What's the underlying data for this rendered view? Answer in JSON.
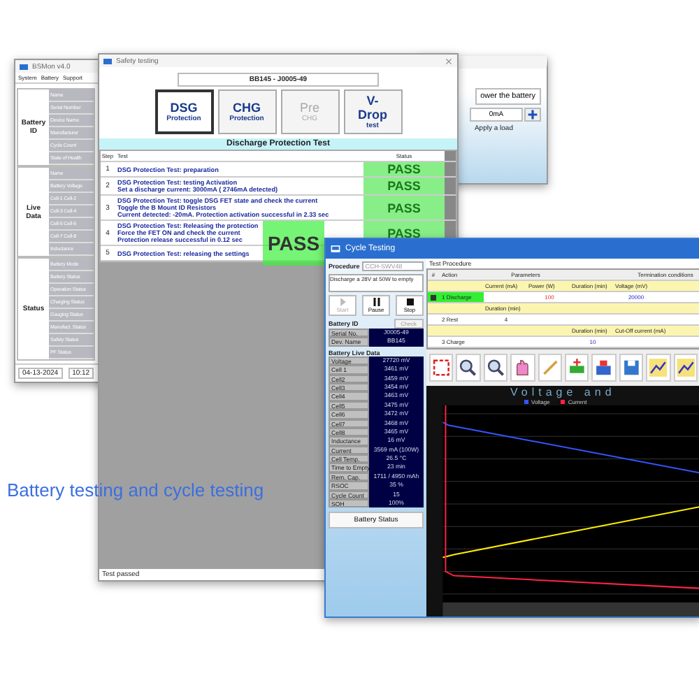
{
  "main_window": {
    "title": "BSMon v4.0",
    "menu": [
      "System",
      "Battery",
      "Support"
    ],
    "groups": [
      {
        "label": "Battery ID",
        "fields": [
          "Name",
          "Serial Number",
          "Device Name",
          "Manufacturer",
          "Cycle Count",
          "State of Health"
        ]
      },
      {
        "label": "Live Data",
        "fields": [
          "Name",
          "Battery Voltage",
          "Cell-1 Cell-2",
          "Cell-3 Cell-4",
          "Cell-5 Cell-6",
          "Cell-7 Cell-8",
          "Inductance"
        ]
      },
      {
        "label": "Status",
        "fields": [
          "Battery Mode",
          "Battery Status",
          "Operation Status",
          "Charging Status",
          "Gauging Status",
          "Manufact. Status",
          "Safety Status",
          "PF Status"
        ]
      }
    ],
    "status_bar": [
      "04-13-2024",
      "10:12"
    ]
  },
  "load_window": {
    "power_button": "ower the battery",
    "current_field": "0mA",
    "apply_label": "Apply a load"
  },
  "safety_window": {
    "title": "Safety testing",
    "battery": "BB145 - J0005-49",
    "tests": [
      {
        "label": "DSG",
        "sub": "Protection",
        "selected": true,
        "disabled": false
      },
      {
        "label": "CHG",
        "sub": "Protection",
        "selected": false,
        "disabled": false
      },
      {
        "label": "Pre",
        "sub": "CHG",
        "selected": false,
        "disabled": true
      },
      {
        "label": "V-Drop",
        "sub": "test",
        "selected": false,
        "disabled": false
      }
    ],
    "section_title": "Discharge Protection Test",
    "columns": [
      "Step",
      "Test",
      "Status"
    ],
    "steps": [
      {
        "step": "1",
        "lines": [
          "DSG Protection Test: preparation"
        ],
        "status": "PASS"
      },
      {
        "step": "2",
        "lines": [
          "DSG Protection Test: testing Activation",
          "Set a discharge current: 3000mA ( 2746mA detected)"
        ],
        "status": "PASS"
      },
      {
        "step": "3",
        "lines": [
          "DSG Protection Test: toggle DSG FET state and check the current",
          "Toggle the B Mount ID Resistors",
          "Current detected: -20mA. Protection activation successful in 2.33 sec"
        ],
        "status": "PASS"
      },
      {
        "step": "4",
        "lines": [
          "DSG Protection Test: Releasing the protection",
          "Force the FET ON and check the current",
          "Protection release successful in 0.12 sec"
        ],
        "status": "PASS"
      },
      {
        "step": "5",
        "lines": [
          "DSG Protection Test: releasing the settings"
        ]
      }
    ],
    "result": "PASS",
    "status_bar": "Test passed"
  },
  "cycle_window": {
    "title": "Cycle Testing",
    "procedure_label": "Procedure",
    "procedure": "CCH-SWV48",
    "description": "Discharge a 28V at 50W to empty",
    "controls": [
      {
        "label": "Start",
        "kind": "start",
        "disabled": true
      },
      {
        "label": "Pause",
        "kind": "pause",
        "disabled": false
      },
      {
        "label": "Stop",
        "kind": "stop",
        "disabled": false
      }
    ],
    "battery_id_label": "Battery ID",
    "check_button": "Check",
    "id_fields": [
      {
        "name": "Serial No.",
        "value": "J0005-49"
      },
      {
        "name": "Dev. Name",
        "value": "BB145"
      }
    ],
    "live_label": "Battery Live Data",
    "live_fields": [
      {
        "name": "Voltage",
        "value": "27720 mV"
      },
      {
        "name": "Cell 1",
        "value": "3461 mV"
      },
      {
        "name": "Cell2",
        "value": "3459 mV"
      },
      {
        "name": "Cell3",
        "value": "3454 mV"
      },
      {
        "name": "Cell4",
        "value": "3463 mV"
      },
      {
        "name": "Cell5",
        "value": "3475 mV"
      },
      {
        "name": "Cell6",
        "value": "3472 mV"
      },
      {
        "name": "Cell7",
        "value": "3468 mV"
      },
      {
        "name": "Cell8",
        "value": "3465 mV"
      },
      {
        "name": "Inductance",
        "value": "16 mV"
      },
      {
        "name": "Current",
        "value": "3569 mA (100W)"
      },
      {
        "name": "Cell Temp.",
        "value": "26.5 °C"
      },
      {
        "name": "Time to Empty",
        "value": "23 min"
      },
      {
        "name": "Rem. Cap.",
        "value": "1711 / 4950 mAh"
      },
      {
        "name": "RSOC",
        "value": "35 %"
      },
      {
        "name": "Cycle Count",
        "value": "15"
      },
      {
        "name": "SOH",
        "value": "100%"
      }
    ],
    "status_button": "Battery Status",
    "procedure_title": "Test Procedure",
    "proc_columns": [
      "#",
      "Action",
      "Parameters",
      "Termination conditions"
    ],
    "proc_rows": [
      {
        "action": "1 Discharge",
        "selected": true,
        "cells": [
          {
            "label": "Current (mA)"
          },
          {
            "label": "Power (W)",
            "value": "100"
          },
          {
            "label": "Duration (min)"
          },
          {
            "label": "Voltage (mV)",
            "value": "20000"
          }
        ]
      },
      {
        "action": "2 Rest",
        "selected": false,
        "cells": [
          {
            "label": "Duration (min)",
            "value": "4"
          },
          null,
          null,
          null
        ]
      },
      {
        "action": "3 Charge",
        "selected": false,
        "cells": [
          null,
          null,
          {
            "label": "Duration (min)",
            "value": "10"
          },
          {
            "label": "Cut-Off current (mA)"
          }
        ]
      }
    ],
    "chart_title": "Voltage and",
    "legend": [
      {
        "label": "Voltage",
        "color": "#3355ff"
      },
      {
        "label": "Current",
        "color": "#ff2244"
      }
    ]
  },
  "caption": "Battery testing and cycle testing"
}
